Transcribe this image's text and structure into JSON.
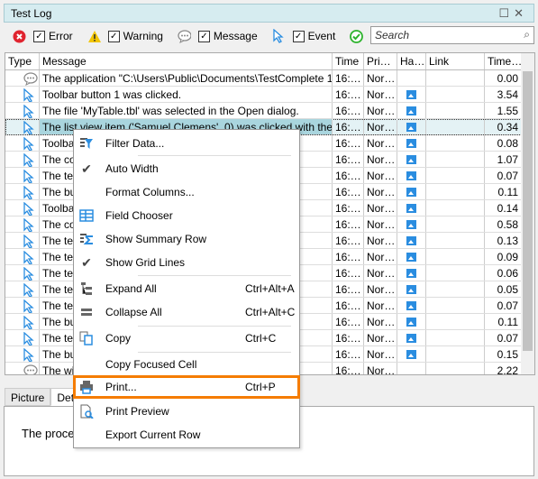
{
  "window": {
    "title": "Test Log"
  },
  "filters": [
    {
      "label": "Error",
      "icon": "error-icon",
      "checked": true
    },
    {
      "label": "Warning",
      "icon": "warning-icon",
      "checked": true
    },
    {
      "label": "Message",
      "icon": "message-icon",
      "checked": true
    },
    {
      "label": "Event",
      "icon": "event-icon",
      "checked": true
    }
  ],
  "search": {
    "placeholder": "Search"
  },
  "columns": [
    "Type",
    "Message",
    "Time",
    "Pri…",
    "Ha…",
    "Link",
    "Time…"
  ],
  "rows": [
    {
      "type": "message",
      "message": "The application \"C:\\Users\\Public\\Documents\\TestComplete 14 S…",
      "time": "16:…",
      "priority": "Nor…",
      "has_picture": false,
      "link": "",
      "time_taken": "0.00"
    },
    {
      "type": "event",
      "message": "Toolbar button 1 was clicked.",
      "time": "16:…",
      "priority": "Nor…",
      "has_picture": true,
      "link": "",
      "time_taken": "3.54"
    },
    {
      "type": "event",
      "message": "The file 'MyTable.tbl' was selected in the Open dialog.",
      "time": "16:…",
      "priority": "Nor…",
      "has_picture": true,
      "link": "",
      "time_taken": "1.55"
    },
    {
      "type": "event",
      "message": "The list view item ('Samuel Clemens', 0) was clicked with the left …",
      "time": "16:…",
      "priority": "Nor…",
      "has_picture": true,
      "link": "",
      "time_taken": "0.34",
      "selected": true
    },
    {
      "type": "event",
      "message": "Toolbar",
      "time": "16:…",
      "priority": "Nor…",
      "has_picture": true,
      "link": "",
      "time_taken": "0.08"
    },
    {
      "type": "event",
      "message": "The cor",
      "time": "16:…",
      "priority": "Nor…",
      "has_picture": true,
      "link": "",
      "time_taken": "1.07"
    },
    {
      "type": "event",
      "message": "The tex",
      "time": "16:…",
      "priority": "Nor…",
      "has_picture": true,
      "link": "",
      "time_taken": "0.07"
    },
    {
      "type": "event",
      "message": "The but",
      "time": "16:…",
      "priority": "Nor…",
      "has_picture": true,
      "link": "",
      "time_taken": "0.11"
    },
    {
      "type": "event",
      "message": "Toolbar",
      "time": "16:…",
      "priority": "Nor…",
      "has_picture": true,
      "link": "",
      "time_taken": "0.14"
    },
    {
      "type": "event",
      "message": "The cor",
      "time": "16:…",
      "priority": "Nor…",
      "has_picture": true,
      "link": "",
      "time_taken": "0.58"
    },
    {
      "type": "event",
      "message": "The tex",
      "time": "16:…",
      "priority": "Nor…",
      "has_picture": true,
      "link": "",
      "time_taken": "0.13"
    },
    {
      "type": "event",
      "message": "The tex",
      "time": "16:…",
      "priority": "Nor…",
      "has_picture": true,
      "link": "",
      "time_taken": "0.09"
    },
    {
      "type": "event",
      "message": "The tex",
      "time": "16:…",
      "priority": "Nor…",
      "has_picture": true,
      "link": "",
      "time_taken": "0.06"
    },
    {
      "type": "event",
      "message": "The tex",
      "time": "16:…",
      "priority": "Nor…",
      "has_picture": true,
      "link": "",
      "time_taken": "0.05"
    },
    {
      "type": "event",
      "message": "The tex",
      "time": "16:…",
      "priority": "Nor…",
      "has_picture": true,
      "link": "",
      "time_taken": "0.07"
    },
    {
      "type": "event",
      "message": "The but",
      "time": "16:…",
      "priority": "Nor…",
      "has_picture": true,
      "link": "",
      "time_taken": "0.11"
    },
    {
      "type": "event",
      "message": "The tex",
      "time": "16:…",
      "priority": "Nor…",
      "has_picture": true,
      "link": "",
      "time_taken": "0.07"
    },
    {
      "type": "event",
      "message": "The but",
      "time": "16:…",
      "priority": "Nor…",
      "has_picture": true,
      "link": "",
      "time_taken": "0.15"
    },
    {
      "type": "message",
      "message": "The wir                                                      lete…",
      "time": "16:…",
      "priority": "Nor…",
      "has_picture": false,
      "link": "",
      "time_taken": "2.22"
    }
  ],
  "tabs": [
    "Picture",
    "Deta"
  ],
  "detail": {
    "text": "The proce"
  },
  "context_menu": {
    "items": [
      {
        "label": "Filter Data...",
        "icon": "filter-icon",
        "shortcut": ""
      },
      {
        "label": "Auto Width",
        "icon": "check-icon",
        "shortcut": "",
        "checked": true
      },
      {
        "label": "Format Columns...",
        "icon": "",
        "shortcut": ""
      },
      {
        "label": "Field Chooser",
        "icon": "field-chooser-icon",
        "shortcut": ""
      },
      {
        "label": "Show Summary Row",
        "icon": "summary-icon",
        "shortcut": ""
      },
      {
        "label": "Show Grid Lines",
        "icon": "check-icon",
        "shortcut": "",
        "checked": true
      },
      {
        "label": "Expand All",
        "icon": "expand-icon",
        "shortcut": "Ctrl+Alt+A"
      },
      {
        "label": "Collapse All",
        "icon": "collapse-icon",
        "shortcut": "Ctrl+Alt+C"
      },
      {
        "label": "Copy",
        "icon": "copy-icon",
        "shortcut": "Ctrl+C"
      },
      {
        "label": "Copy Focused Cell",
        "icon": "",
        "shortcut": ""
      },
      {
        "label": "Print...",
        "icon": "printer-icon",
        "shortcut": "Ctrl+P",
        "highlighted": true
      },
      {
        "label": "Print Preview",
        "icon": "print-preview-icon",
        "shortcut": ""
      },
      {
        "label": "Export Current Row",
        "icon": "",
        "shortcut": ""
      }
    ]
  },
  "colors": {
    "accent": "#f57c00",
    "selection": "#a9d5de",
    "title_bg": "#d6ecf0",
    "event": "#2a8de0",
    "error": "#e0242f",
    "warning": "#f2c500",
    "ok": "#2cb32c"
  }
}
